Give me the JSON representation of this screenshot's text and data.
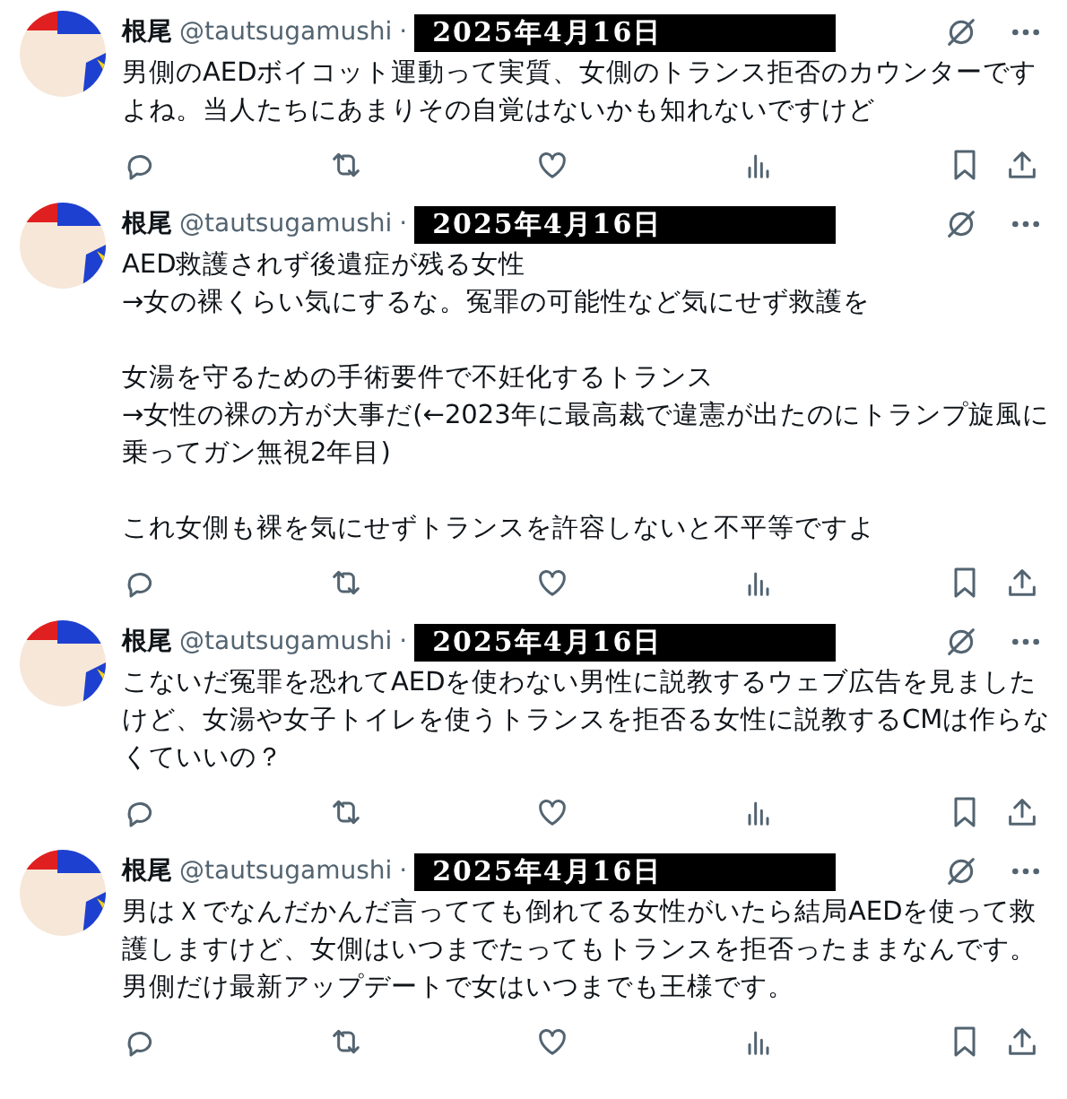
{
  "posts": [
    {
      "name": "根尾",
      "handle": "@tautsugamushi",
      "separator": "·",
      "date": "2025年4月16日",
      "paragraphs": [
        [
          "男側のAEDボイコット運動って実質、女側のトランス拒否のカウンターですよね。当人たちにあまりその自覚はないかも知れないですけど"
        ]
      ]
    },
    {
      "name": "根尾",
      "handle": "@tautsugamushi",
      "separator": "·",
      "date": "2025年4月16日",
      "paragraphs": [
        [
          "AED救護されず後遺症が残る女性",
          "→女の裸くらい気にするな。冤罪の可能性など気にせず救護を"
        ],
        [
          "女湯を守るための手術要件で不妊化するトランス",
          "→女性の裸の方が大事だ(←2023年に最高裁で違憲が出たのにトランプ旋風に乗ってガン無視2年目)"
        ],
        [
          "これ女側も裸を気にせずトランスを許容しないと不平等ですよ"
        ]
      ]
    },
    {
      "name": "根尾",
      "handle": "@tautsugamushi",
      "separator": "·",
      "date": "2025年4月16日",
      "paragraphs": [
        [
          "こないだ冤罪を恐れてAEDを使わない男性に説教するウェブ広告を見ましたけど、女湯や女子トイレを使うトランスを拒否る女性に説教するCMは作らなくていいの？"
        ]
      ]
    },
    {
      "name": "根尾",
      "handle": "@tautsugamushi",
      "separator": "·",
      "date": "2025年4月16日",
      "paragraphs": [
        [
          "男はＸでなんだかんだ言ってても倒れてる女性がいたら結局AEDを使って救護しますけど、女側はいつまでたってもトランスを拒否ったままなんです。男側だけ最新アップデートで女はいつまでも王様です。"
        ]
      ]
    }
  ]
}
